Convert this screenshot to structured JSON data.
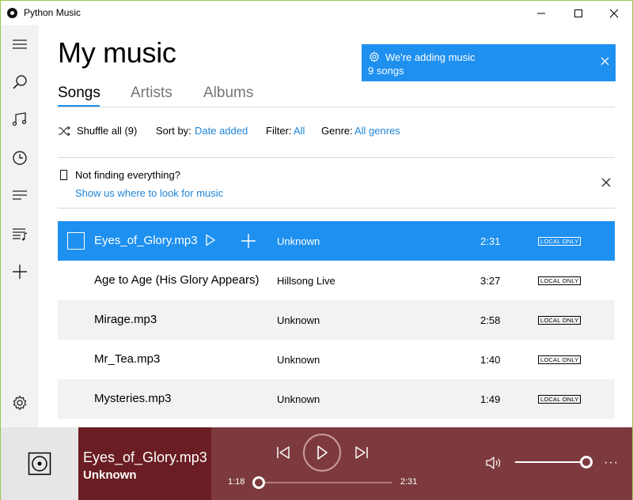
{
  "window": {
    "title": "Python Music",
    "app_icon": "disc-icon",
    "controls": [
      "minimize-icon",
      "maximize-icon",
      "close-icon"
    ]
  },
  "sidebar": {
    "items": [
      {
        "icon": "hamburger-menu-icon"
      },
      {
        "icon": "search-icon"
      },
      {
        "icon": "music-note-icon"
      },
      {
        "icon": "clock-icon"
      },
      {
        "icon": "now-playing-list-icon"
      },
      {
        "icon": "playlist-icon"
      },
      {
        "icon": "plus-icon"
      },
      {
        "icon": "gear-icon"
      }
    ]
  },
  "main": {
    "title": "My music",
    "tabs": [
      {
        "label": "Songs",
        "active": true
      },
      {
        "label": "Artists",
        "active": false
      },
      {
        "label": "Albums",
        "active": false
      }
    ],
    "filters": {
      "shuffle_label": "Shuffle all (9)",
      "sort_label": "Sort by:",
      "sort_value": "Date added",
      "filter_label": "Filter:",
      "filter_value": "All",
      "genre_label": "Genre:",
      "genre_value": "All genres"
    },
    "notice": {
      "text": "Not finding everything?",
      "link": "Show us where to look for music"
    }
  },
  "toast": {
    "title": "We're adding music",
    "subtitle": "9 songs",
    "color": "#1e90f0"
  },
  "songs": [
    {
      "title": "Eyes_of_Glory.mp3",
      "artist": "Unknown",
      "duration": "2:31",
      "badge": "LOCAL ONLY",
      "selected": true
    },
    {
      "title": "Age to Age (His Glory Appears)",
      "artist": "Hillsong Live",
      "duration": "3:27",
      "badge": "LOCAL ONLY",
      "selected": false
    },
    {
      "title": "Mirage.mp3",
      "artist": "Unknown",
      "duration": "2:58",
      "badge": "LOCAL ONLY",
      "selected": false
    },
    {
      "title": "Mr_Tea.mp3",
      "artist": "Unknown",
      "duration": "1:40",
      "badge": "LOCAL ONLY",
      "selected": false
    },
    {
      "title": "Mysteries.mp3",
      "artist": "Unknown",
      "duration": "1:49",
      "badge": "LOCAL ONLY",
      "selected": false
    }
  ],
  "player": {
    "title": "Eyes_of_Glory.mp3",
    "artist": "Unknown",
    "elapsed": "1:18",
    "total": "2:31",
    "progress_fraction": 0.0,
    "volume_fraction": 1.0,
    "more_label": "···",
    "accent": "#7d3a3e",
    "info_bg": "#6a1d22"
  }
}
